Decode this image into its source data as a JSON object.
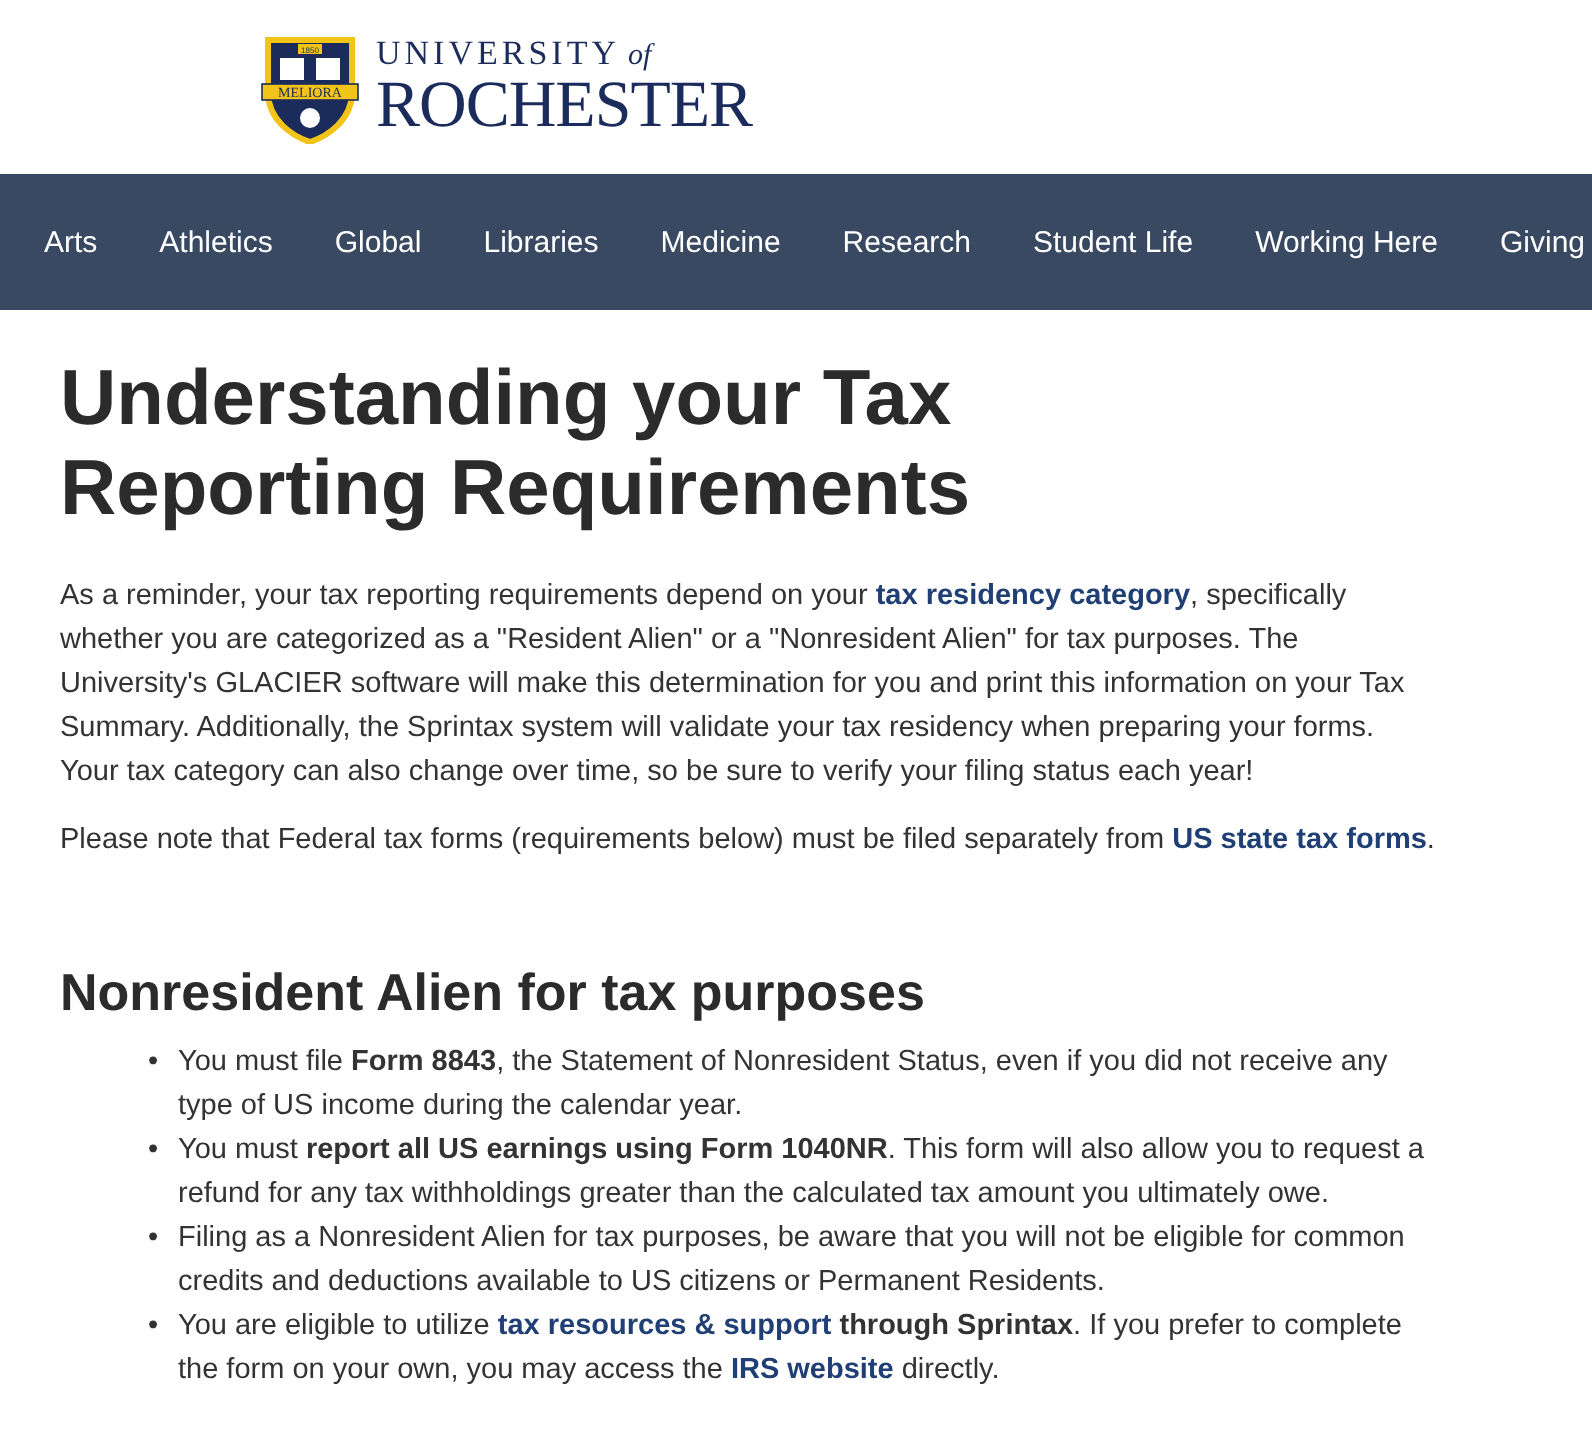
{
  "logo": {
    "year": "1850",
    "motto": "MELIORA",
    "line1": "UNIVERSITY",
    "line1_suffix": "of",
    "line2": "ROCHESTER"
  },
  "nav": [
    {
      "label": "Arts"
    },
    {
      "label": "Athletics"
    },
    {
      "label": "Global"
    },
    {
      "label": "Libraries"
    },
    {
      "label": "Medicine"
    },
    {
      "label": "Research"
    },
    {
      "label": "Student Life"
    },
    {
      "label": "Working Here"
    },
    {
      "label": "Giving"
    }
  ],
  "title": "Understanding your Tax Reporting Requirements",
  "intro": [
    [
      {
        "kind": "text",
        "text": "As a reminder, your tax reporting requirements depend on your "
      },
      {
        "kind": "link",
        "text": "tax residency category"
      },
      {
        "kind": "text",
        "text": ", specifically whether you are categorized as a \"Resident Alien\" or a \"Nonresident Alien\" for tax purposes. The University's GLACIER software will make this determination for you and print this information on your Tax Summary. Additionally, the Sprintax system will validate your tax residency when preparing your forms. Your tax category can also change over time, so be sure to verify your filing status each year!"
      }
    ],
    [
      {
        "kind": "text",
        "text": "Please note that Federal tax forms (requirements below) must be filed separately from "
      },
      {
        "kind": "link",
        "text": "US state tax forms"
      },
      {
        "kind": "text",
        "text": "."
      }
    ]
  ],
  "section": {
    "heading": "Nonresident Alien for tax purposes",
    "marker": "•",
    "bullets": [
      [
        {
          "kind": "text",
          "text": "You must file **Form 8843**, the Statement of Nonresident Status, even if you did not receive any type of US income during the calendar year."
        }
      ],
      [
        {
          "kind": "text",
          "text": "You must **report all US earnings using Form 1040NR**. This form will also allow you to request a refund for any tax withholdings greater than the calculated tax amount you ultimately owe."
        }
      ],
      [
        {
          "kind": "text",
          "text": "Filing as a Nonresident Alien for tax purposes, be aware that you will not be eligible for common credits and deductions available to US citizens or Permanent Residents."
        }
      ],
      [
        {
          "kind": "text",
          "text": "You are eligible to utilize "
        },
        {
          "kind": "link",
          "text": "tax resources & support"
        },
        {
          "kind": "text",
          "text": " **through Sprintax**. If you prefer to complete the form on your own, you may access the "
        },
        {
          "kind": "link",
          "text": "IRS website"
        },
        {
          "kind": "text",
          "text": " directly."
        }
      ]
    ]
  }
}
